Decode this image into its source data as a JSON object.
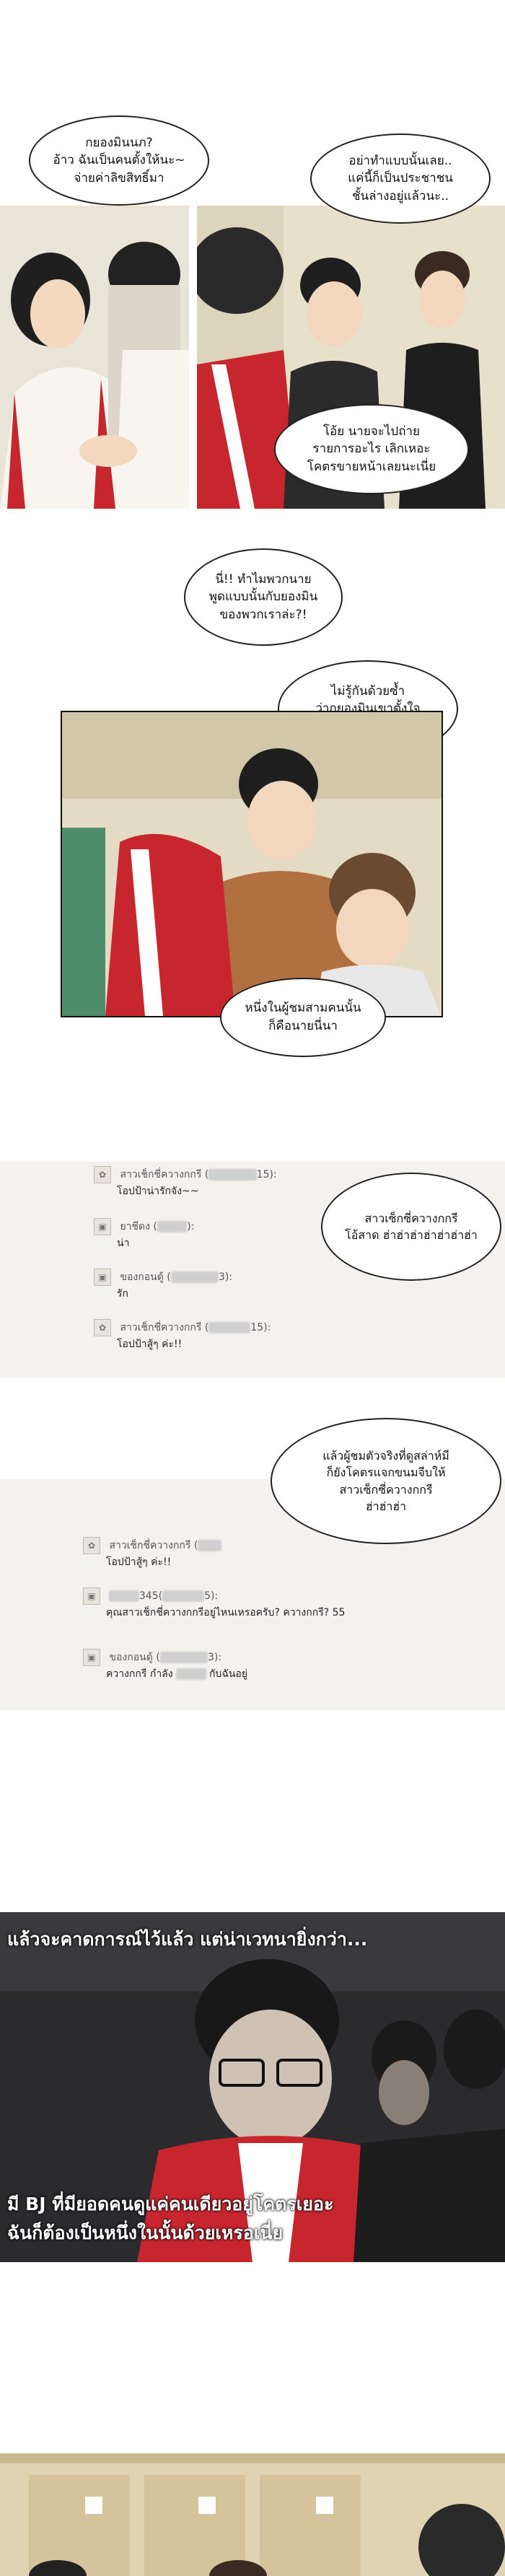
{
  "panel1": {
    "bubble_left": "กยองมินนภ?\nอ้าว ฉันเป็นคนตั้งให้นะ~\nจ่ายค่าลิขสิทธิ์มา",
    "bubble_right_top": "อย่าทำแบบนั้นเลย..\nแค่นี้ก็เป็นประชาชน\nชั้นล่างอยู่แล้วนะ..",
    "bubble_right_bottom": "โอ้ย นายจะไปถ่าย\nรายการอะไร เลิกเหอะ\nโคตรขายหน้าเลยนะเนี่ย"
  },
  "panel2": {
    "bubble_top": "นี่!! ทำไมพวกนาย\nพูดแบบนั้นกับยองมิน\nของพวกเราล่ะ?!",
    "bubble_right": "ไม่รู้กันด้วยซ้ำ\nว่ากยองมินเขาตั้งใจ\nเตรียมมาขนาดไหน..",
    "bubble_bottom": "หนึ่งในผู้ชมสามคนนั้น\nก็คือนายนี่นา"
  },
  "chat1": {
    "rows": [
      {
        "name": "สาวเช็กชี่ควางกกรี (",
        "msg": "โอปป้าน่ารักจัง~~",
        "suffix": "15):"
      },
      {
        "name": "ยาชีดง (",
        "msg": "น่า",
        "suffix": "):"
      },
      {
        "name": "ของกอนดู้ (",
        "msg": "รัก",
        "suffix": "3):"
      },
      {
        "name": "สาวเช็กชี่ควางกกรี (",
        "msg": "โอปป้าสู้ๆ ค่ะ!!",
        "suffix": "15):"
      }
    ],
    "bubble": "สาวเซ็กซี่ควางกกรี\nโอ้สาด ฮ่าฮ่าฮ่าฮ่าฮ่าฮ่าฮ่า"
  },
  "chat2": {
    "bubble": "แล้วผู้ชมตัวจริงที่ดูสล่าห์มี\nก็ยังโคตรแจกขนมจีบให้\nสาวเซ็กซี่ควางกกรี\nฮ่าฮ่าฮ่า",
    "rows": [
      {
        "name": "สาวเช็กชี่ควางกกรี (",
        "msg": "โอปป้าสู้ๆ ค่ะ!!",
        "suffix": ""
      },
      {
        "name": "345(",
        "msg": "คุณสาวเช็กชี่ควางกกรีอยู่ไหนเหรอครับ? ควางกกรี? 55",
        "suffix": "5):"
      },
      {
        "name": "ของกอนดู้ (",
        "msg": "ควางกกรี กำลัง",
        "msg2": "กับฉันอยู่",
        "suffix": "3):"
      }
    ]
  },
  "panel3": {
    "caption_top": "แล้วจะคาดการณ์ไว้แล้ว แต่น่าเวทนายิ่งกว่า...",
    "caption_bottom_1": "มี BJ ที่มียอดคนดูแค่คนเดียวอยู่โคตรเยอะ",
    "caption_bottom_2": "ฉันก็ต้องเป็นหนึ่งในนั้นด้วยเหรอเนี่ย"
  },
  "colors": {
    "jacket_red": "#c8262e",
    "chat_bg": "#f3f2ef",
    "panel3_bg": "#2a2a2c"
  }
}
